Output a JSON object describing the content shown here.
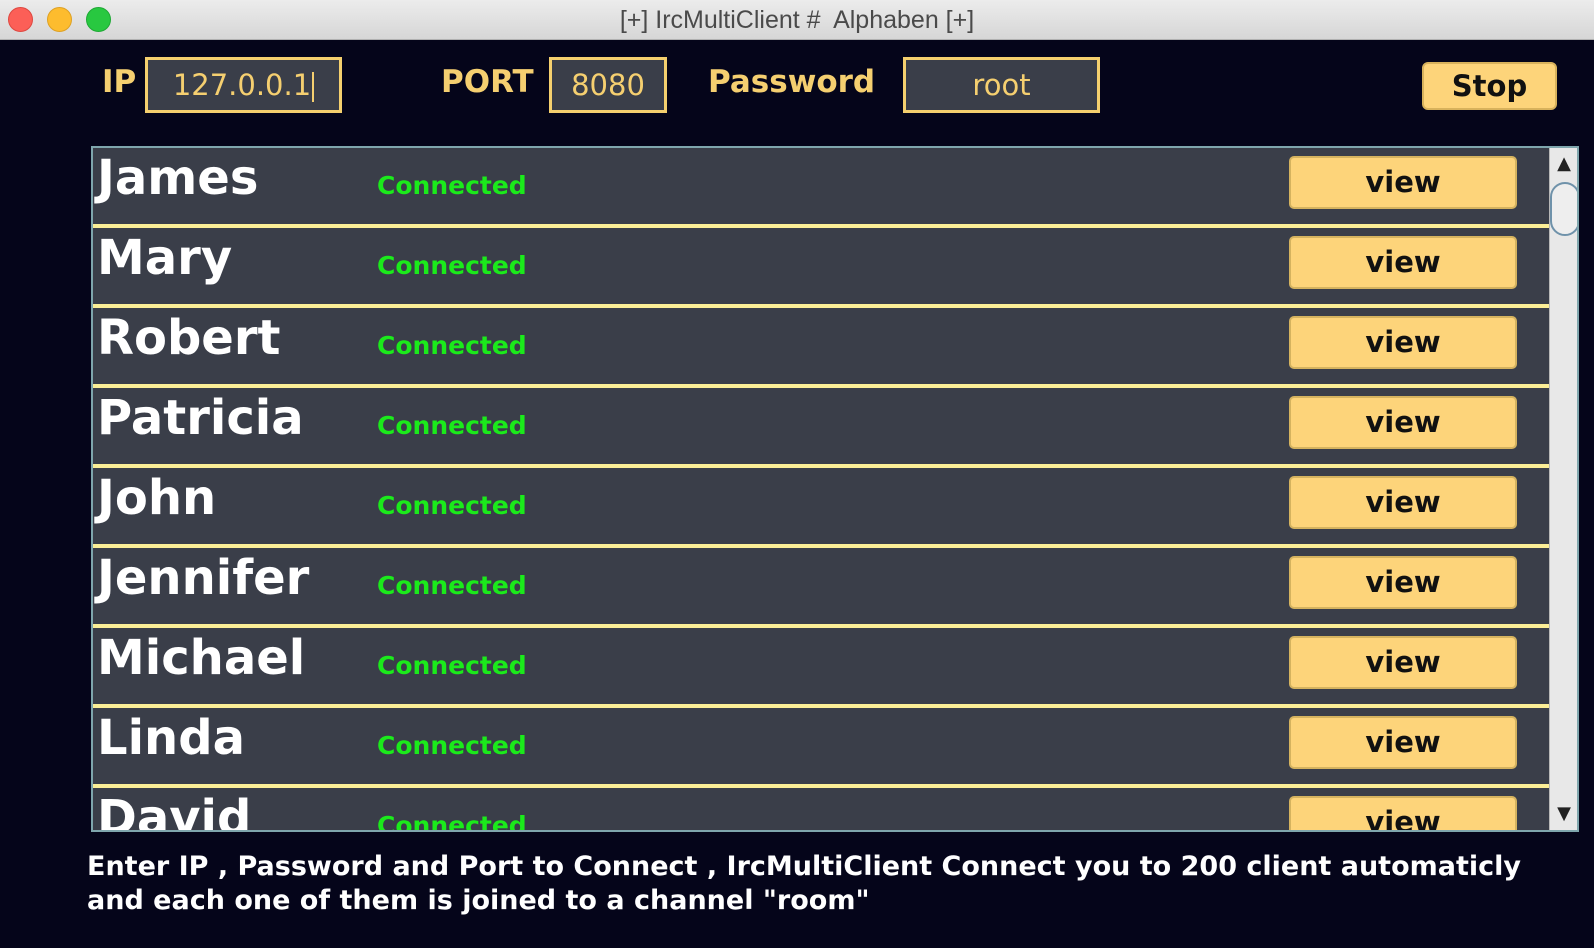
{
  "window": {
    "title": "[+] IrcMultiClient #  Alphaben [+]"
  },
  "connection": {
    "ip_label": "IP",
    "ip_value": "127.0.0.1",
    "port_label": "PORT",
    "port_value": "8080",
    "password_label": "Password",
    "password_value": "root",
    "stop_label": "Stop"
  },
  "clients": [
    {
      "name": "James",
      "status": "Connected",
      "action": "view"
    },
    {
      "name": "Mary",
      "status": "Connected",
      "action": "view"
    },
    {
      "name": "Robert",
      "status": "Connected",
      "action": "view"
    },
    {
      "name": "Patricia",
      "status": "Connected",
      "action": "view"
    },
    {
      "name": "John",
      "status": "Connected",
      "action": "view"
    },
    {
      "name": "Jennifer",
      "status": "Connected",
      "action": "view"
    },
    {
      "name": "Michael",
      "status": "Connected",
      "action": "view"
    },
    {
      "name": "Linda",
      "status": "Connected",
      "action": "view"
    },
    {
      "name": "David",
      "status": "Connected",
      "action": "view"
    }
  ],
  "scrollbar": {
    "up_icon": "▲",
    "down_icon": "▼"
  },
  "footer": {
    "line1": "Enter IP , Password and Port to Connect , IrcMultiClient Connect you to 200 client automaticly",
    "line2": "and each one of them is joined to a channel \"room\""
  },
  "colors": {
    "accent": "#fdd47a",
    "status_connected": "#1bea1b",
    "row_divider": "#fbee97",
    "background": "#05051a",
    "row_bg": "#3a3e49"
  }
}
